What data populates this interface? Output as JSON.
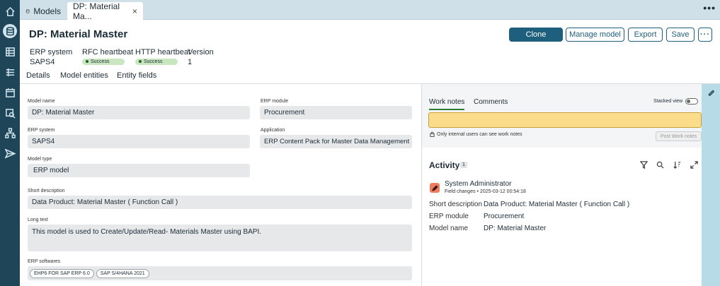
{
  "tabs": [
    {
      "label": "Models",
      "icon": "database-icon"
    },
    {
      "label": "DP: Material Ma...",
      "close": "×"
    }
  ],
  "tab_menu": "•••",
  "page": {
    "title": "DP: Material Master",
    "actions": {
      "clone": "Clone",
      "manage": "Manage model",
      "export": "Export",
      "save": "Save",
      "more": "···"
    }
  },
  "meta": {
    "erp_system": {
      "label": "ERP system",
      "value": "SAPS4"
    },
    "rfc": {
      "label": "RFC heartbeat",
      "status": "Success"
    },
    "http": {
      "label": "HTTP heartbeat",
      "status": "Success"
    },
    "version": {
      "label": "Version",
      "value": "1"
    }
  },
  "subtabs": [
    "Details",
    "Model entities",
    "Entity fields"
  ],
  "form": {
    "model_name": {
      "label": "Model name",
      "value": "DP: Material Master"
    },
    "erp_module": {
      "label": "ERP module",
      "value": "Procurement"
    },
    "erp_system": {
      "label": "ERP system",
      "value": "SAPS4"
    },
    "application": {
      "label": "Application",
      "value": "ERP Content Pack for Master Data Management"
    },
    "model_type": {
      "label": "Model type",
      "value": "ERP model"
    },
    "short_description": {
      "label": "Short description",
      "value": "Data Product: Material Master  ( Function Call )"
    },
    "long_text": {
      "label": "Long text",
      "value": "This model is used to Create/Update/Read- Materials Master using BAPI."
    },
    "erp_softwares": {
      "label": "ERP softwares",
      "chips": [
        "EHP6 FOR SAP ERP 6.0",
        "SAP S/4HANA 2021"
      ]
    }
  },
  "notes": {
    "tabs": [
      "Work notes",
      "Comments"
    ],
    "stacked_view": "Stacked view",
    "internal_note": "Only internal users can see work notes",
    "post_button": "Post Work notes"
  },
  "activity": {
    "title": "Activity",
    "count": "1",
    "user": "System Administrator",
    "change_meta": "Field changes • 2025-03-12 00:54:18",
    "changes": [
      {
        "field": "Short description",
        "value": "Data Product: Material Master ( Function Call )"
      },
      {
        "field": "ERP module",
        "value": "Procurement"
      },
      {
        "field": "Model name",
        "value": "DP: Material Master"
      }
    ]
  },
  "colors": {
    "rail": "#1e4658",
    "primary": "#1e5f7e",
    "success": "#c8e6c0",
    "work_note": "#fbdc8b"
  }
}
